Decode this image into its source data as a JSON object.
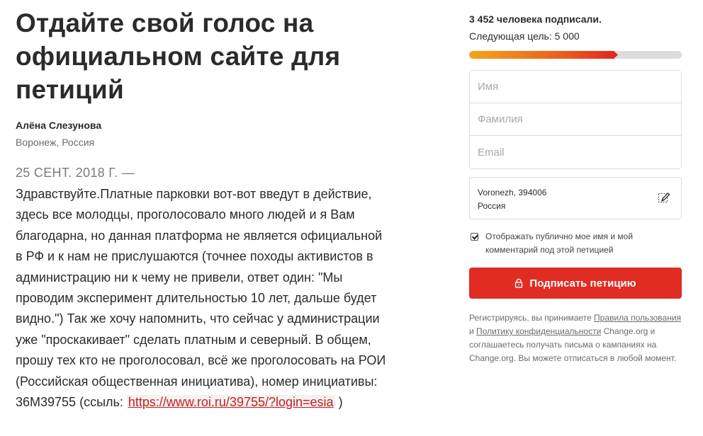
{
  "petition": {
    "title_lines": [
      "Отдайте свой голос на",
      "официальном сайте для",
      "петиций"
    ],
    "author": "Алёна Слезунова",
    "location": "Воронеж, Россия",
    "date": "25 СЕНТ. 2018 Г. —",
    "body_lines": [
      "Здравствуйте.Платные парковки вот-вот введут в действие,",
      "здесь все молодцы, проголосовало много людей и я Вам",
      "благодарна, но данная платформа не является официальной",
      "в РФ и к нам не прислушаются (точнее походы активистов в",
      "администрацию ни к чему не привели, ответ один: \"Мы",
      "проводим эксперимент длительностью 10 лет, дальше будет",
      "видно.\") Так же хочу напомнить, что сейчас у администрации",
      "уже \"проскакивает\" сделать платным и северный. В общем,",
      "прошу тех кто не проголосовал, всё же проголосовать на РОИ",
      "(Российская общественная инициатива), номер инициативы:"
    ],
    "last_line_prefix": "36М39755 (ссыль: ",
    "link_text": "https://www.roi.ru/39755/?login=esia",
    "last_line_suffix": " )"
  },
  "sidebar": {
    "signed_count": "3 452 человека подписали.",
    "next_goal": "Следующая цель: 5 000",
    "progress_fraction": 0.7,
    "fields": {
      "first_name_placeholder": "Имя",
      "last_name_placeholder": "Фамилия",
      "email_placeholder": "Email"
    },
    "address_line1": "Voronezh, 394006",
    "address_line2": "Россия",
    "consent_text": "Отображать публично мое имя и мой комментарий под этой петицией",
    "consent_checked": true,
    "sign_button": "Подписать петицию",
    "legal": {
      "part1": "Регистрируясь, вы принимаете ",
      "terms_link": "Правила пользования",
      "part2": " и ",
      "privacy_link": "Политику конфиденциальности",
      "part3": " Change.org и соглашаетесь получать письма о кампаниях на Change.org. Вы можете отписаться в любой момент."
    }
  },
  "colors": {
    "accent": "#e02c23",
    "progress_start": "#f3a51b",
    "progress_end": "#e0241f",
    "track": "#dcdcdc"
  },
  "icons": {
    "edit": "pencil-edit-icon",
    "lock": "lock-icon"
  }
}
